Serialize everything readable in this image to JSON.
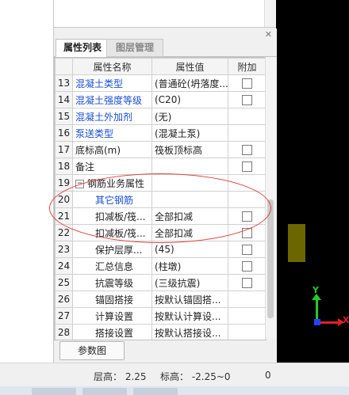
{
  "tabs": {
    "active": "属性列表",
    "inactive": "图层管理"
  },
  "table": {
    "headers": {
      "num": "",
      "name": "属性名称",
      "value": "属性值",
      "attach": "附加"
    },
    "rows": [
      {
        "num": "13",
        "name": "混凝土类型",
        "value": "(普通砼(坍落度...",
        "blue": true,
        "checkbox": true
      },
      {
        "num": "14",
        "name": "混凝土强度等级",
        "value": "(C20)",
        "blue": true,
        "checkbox": true
      },
      {
        "num": "15",
        "name": "混凝土外加剂",
        "value": "(无)",
        "blue": true,
        "checkbox": false
      },
      {
        "num": "16",
        "name": "泵送类型",
        "value": "(混凝土泵)",
        "blue": true,
        "checkbox": false
      },
      {
        "num": "17",
        "name": "底标高(m)",
        "value": "筏板顶标高",
        "blue": false,
        "checkbox": true
      },
      {
        "num": "18",
        "name": "备注",
        "value": "",
        "blue": false,
        "checkbox": true
      },
      {
        "num": "19",
        "name": "钢筋业务属性",
        "value": "",
        "blue": false,
        "checkbox": false,
        "group": true,
        "expander": "−"
      },
      {
        "num": "20",
        "name": "其它钢筋",
        "value": "",
        "blue": true,
        "checkbox": false,
        "indent": 2
      },
      {
        "num": "21",
        "name": "扣减板/筏...",
        "value": "全部扣减",
        "blue": false,
        "checkbox": true,
        "indent": 2
      },
      {
        "num": "22",
        "name": "扣减板/筏...",
        "value": "全部扣减",
        "blue": false,
        "checkbox": true,
        "indent": 2
      },
      {
        "num": "23",
        "name": "保护层厚...",
        "value": "(45)",
        "blue": false,
        "checkbox": true,
        "indent": 2
      },
      {
        "num": "24",
        "name": "汇总信息",
        "value": "(柱墩)",
        "blue": false,
        "checkbox": true,
        "indent": 2
      },
      {
        "num": "25",
        "name": "抗震等级",
        "value": "(三级抗震)",
        "blue": false,
        "checkbox": true,
        "indent": 2
      },
      {
        "num": "26",
        "name": "锚固搭接",
        "value": "按默认锚固搭...",
        "blue": false,
        "checkbox": false,
        "indent": 2
      },
      {
        "num": "27",
        "name": "计算设置",
        "value": "按默认计算设...",
        "blue": false,
        "checkbox": false,
        "indent": 2
      },
      {
        "num": "28",
        "name": "搭接设置",
        "value": "按默认搭接设...",
        "blue": false,
        "checkbox": false,
        "indent": 2
      }
    ]
  },
  "buttons": {
    "params": "参数图"
  },
  "status": {
    "floor_height": "层高： 2.25",
    "elevation": "标高： -2.25~0",
    "value": "0"
  },
  "axes": {
    "y": "Y",
    "x": "X"
  },
  "colors": {
    "blue_text": "#1a4fd0",
    "annotation": "#e04040"
  }
}
